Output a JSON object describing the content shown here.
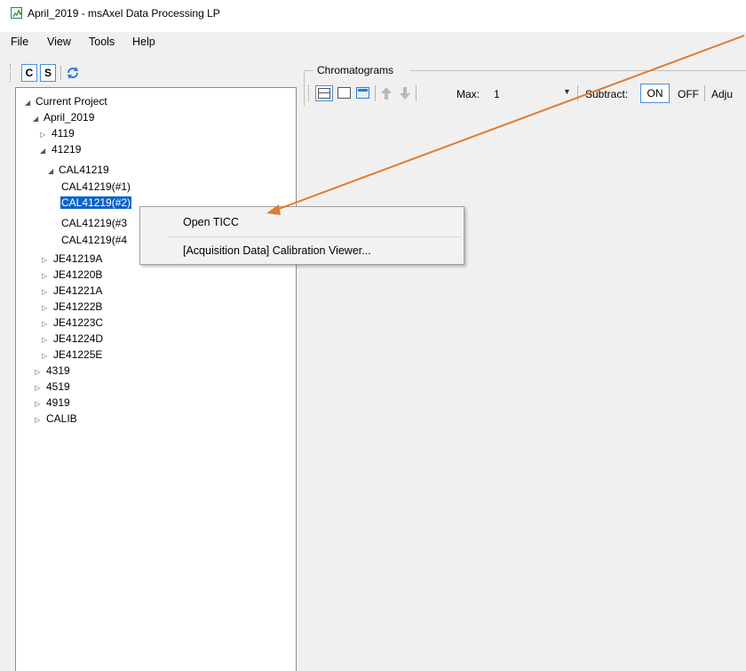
{
  "window": {
    "title": "April_2019 - msAxel Data Processing LP"
  },
  "menubar": {
    "items": [
      "File",
      "View",
      "Tools",
      "Help"
    ]
  },
  "left_toolbar": {
    "c_label": "C",
    "s_label": "S"
  },
  "tree": {
    "nodes": [
      "Current Project",
      "April_2019",
      "4119",
      "41219",
      "CAL41219",
      "CAL41219(#1)",
      "CAL41219(#2)",
      "CAL41219(#3",
      "CAL41219(#4",
      "JE41219A",
      "JE41220B",
      "JE41221A",
      "JE41222B",
      "JE41223C",
      "JE41224D",
      "JE41225E",
      "4319",
      "4519",
      "4919",
      "CALIB"
    ]
  },
  "chromatograms": {
    "title": "Chromatograms",
    "max_label": "Max:",
    "max_value": "1",
    "subtract_label": "Subtract:",
    "on_label": "ON",
    "off_label": "OFF",
    "adjust_label": "Adju"
  },
  "context_menu": {
    "items": [
      "Open TICC",
      "[Acquisition Data] Calibration Viewer..."
    ]
  },
  "colors": {
    "selection": "#0a64c8",
    "annotation_arrow": "#e07a2e",
    "accent_border": "#4a90d9"
  }
}
